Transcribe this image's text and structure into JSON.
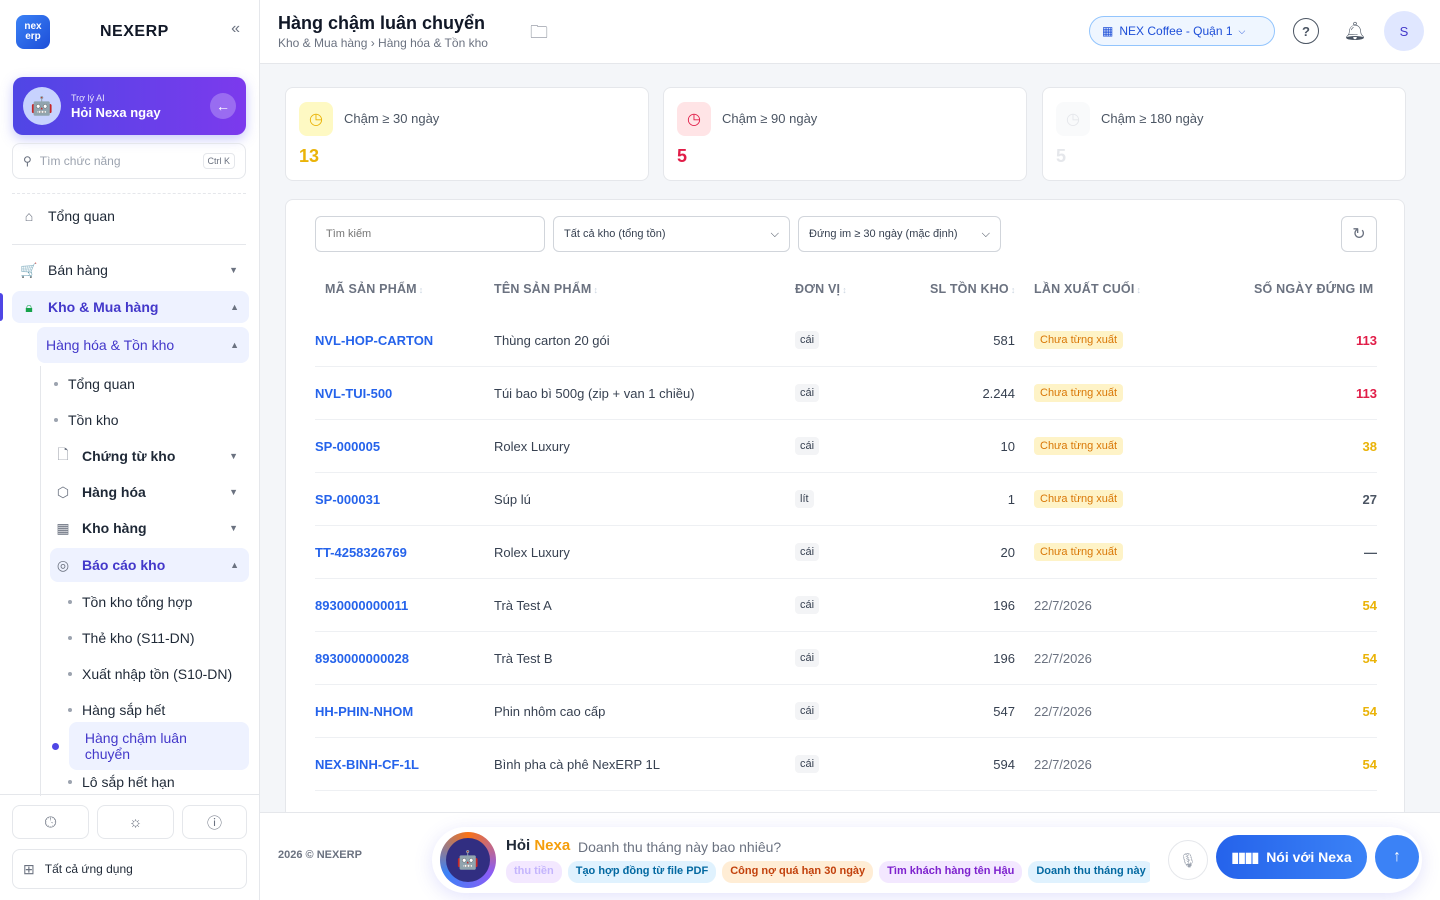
{
  "brand": {
    "logo_text": "nex erp",
    "name": "NEXERP"
  },
  "ai_card": {
    "subtitle": "Trợ lý AI",
    "title": "Hỏi Nexa ngay"
  },
  "search_fn": {
    "placeholder": "Tìm chức năng",
    "shortcut": "Ctrl K"
  },
  "nav": {
    "overview": "Tổng quan",
    "sales": "Bán hàng",
    "warehouse": "Kho & Mua hàng",
    "goods_stock": "Hàng hóa & Tồn kho",
    "sub_overview": "Tổng quan",
    "stock": "Tồn kho",
    "stock_docs": "Chứng từ kho",
    "goods": "Hàng hóa",
    "warehouses": "Kho hàng",
    "stock_reports": "Báo cáo kho",
    "reports": [
      "Tồn kho tổng hợp",
      "Thẻ kho (S11-DN)",
      "Xuất nhập tồn (S10-DN)",
      "Hàng sắp hết",
      "Hàng chậm luân chuyển",
      "Lô sắp hết hạn"
    ]
  },
  "all_apps": "Tất cả ứng dụng",
  "header": {
    "title": "Hàng chậm luân chuyển",
    "breadcrumb": "Kho & Mua hàng › Hàng hóa & Tồn kho",
    "store": "NEX Coffee - Quận 1",
    "avatar": "S"
  },
  "stats": [
    {
      "label": "Chậm ≥ 30 ngày",
      "value": "13",
      "color": "#eab308"
    },
    {
      "label": "Chậm ≥ 90 ngày",
      "value": "5",
      "color": "#e11d48"
    },
    {
      "label": "Chậm ≥ 180 ngày",
      "value": "5",
      "color": "#e5e7eb"
    }
  ],
  "filters": {
    "search_placeholder": "Tìm kiếm",
    "warehouse": "Tất cả kho (tổng tồn)",
    "idle": "Đứng im ≥ 30 ngày (mặc định)"
  },
  "columns": [
    "MÃ SẢN PHẨM",
    "TÊN SẢN PHẨM",
    "ĐƠN VỊ",
    "SL TỒN KHO",
    "LẦN XUẤT CUỐI",
    "SỐ NGÀY ĐỨNG IM"
  ],
  "rows": [
    {
      "code": "NVL-HOP-CARTON",
      "name": "Thùng carton 20 gói",
      "unit": "cái",
      "qty": "581",
      "last": "Chưa từng xuất",
      "days": "113",
      "days_color": "#e11d48"
    },
    {
      "code": "NVL-TUI-500",
      "name": "Túi bao bì 500g (zip + van 1 chiều)",
      "unit": "cái",
      "qty": "2.244",
      "last": "Chưa từng xuất",
      "days": "113",
      "days_color": "#e11d48"
    },
    {
      "code": "SP-000005",
      "name": "Rolex Luxury",
      "unit": "cái",
      "qty": "10",
      "last": "Chưa từng xuất",
      "days": "38",
      "days_color": "#eab308"
    },
    {
      "code": "SP-000031",
      "name": "Súp lú",
      "unit": "lít",
      "qty": "1",
      "last": "Chưa từng xuất",
      "days": "27",
      "days_color": "#4b5563"
    },
    {
      "code": "TT-4258326769",
      "name": "Rolex Luxury",
      "unit": "cái",
      "qty": "20",
      "last": "Chưa từng xuất",
      "days": "—",
      "days_color": "#4b5563"
    },
    {
      "code": "8930000000011",
      "name": "Trà Test A",
      "unit": "cái",
      "qty": "196",
      "last": "22/7/2026",
      "days": "54",
      "days_color": "#eab308"
    },
    {
      "code": "8930000000028",
      "name": "Trà Test B",
      "unit": "cái",
      "qty": "196",
      "last": "22/7/2026",
      "days": "54",
      "days_color": "#eab308"
    },
    {
      "code": "HH-PHIN-NHOM",
      "name": "Phin nhôm cao cấp",
      "unit": "cái",
      "qty": "547",
      "last": "22/7/2026",
      "days": "54",
      "days_color": "#eab308"
    },
    {
      "code": "NEX-BINH-CF-1L",
      "name": "Bình pha cà phê NexERP 1L",
      "unit": "cái",
      "qty": "594",
      "last": "22/7/2026",
      "days": "54",
      "days_color": "#eab308"
    }
  ],
  "footer": {
    "copyright": "2026 © NEXERP",
    "ask_prefix": "Hỏi",
    "ask_brand": "Nexa",
    "ask_question": "Doanh thu tháng này bao nhiêu?",
    "chips": [
      {
        "label": "thu tiền",
        "bg": "#f3e8ff",
        "fg": "#c4b5fd"
      },
      {
        "label": "Tạo hợp đồng từ file PDF",
        "bg": "#e0f2fe",
        "fg": "#0369a1"
      },
      {
        "label": "Công nợ quá hạn 30 ngày",
        "bg": "#ffedd5",
        "fg": "#c2410c"
      },
      {
        "label": "Tìm khách hàng tên Hậu",
        "bg": "#f3e8ff",
        "fg": "#7e22ce"
      },
      {
        "label": "Doanh thu tháng này",
        "bg": "#e0f2fe",
        "fg": "#0369a1"
      }
    ],
    "talk_label": "Nói với Nexa"
  }
}
